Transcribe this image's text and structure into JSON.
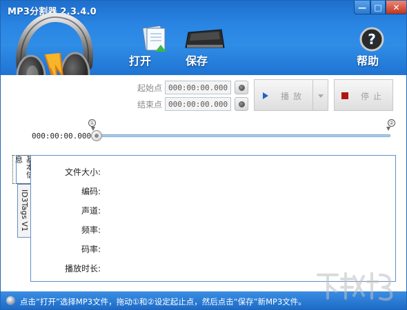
{
  "window": {
    "title": "MP3分割器 2.3.4.0",
    "minimize_label": "—",
    "maximize_label": "□",
    "close_label": "✕"
  },
  "toolbar": {
    "open_label": "打开",
    "save_label": "保存",
    "help_label": "帮助"
  },
  "controls": {
    "start_label": "起始点",
    "start_value": "000:00:00.000",
    "end_label": "结束点",
    "end_value": "000:00:00.000",
    "play_label": "播放",
    "stop_label": "停止"
  },
  "slider": {
    "current_time": "000:00:00.000",
    "position": 0,
    "marker_start": "①",
    "marker_end": "②"
  },
  "tabs": [
    {
      "label": "基本信息"
    },
    {
      "label": "ID3Tags V1"
    }
  ],
  "info_fields": [
    {
      "label": "文件大小:",
      "value": ""
    },
    {
      "label": "编码:",
      "value": ""
    },
    {
      "label": "声道:",
      "value": ""
    },
    {
      "label": "频率:",
      "value": ""
    },
    {
      "label": "码率:",
      "value": ""
    },
    {
      "label": "播放时长:",
      "value": ""
    }
  ],
  "status": {
    "text": "点击“打开”选择MP3文件，拖动①和②设定起止点，然后点击“保存”新MP3文件。"
  },
  "colors": {
    "header_blue": "#2a86e4",
    "panel_border": "#5f8fc7",
    "stop_red": "#b21414",
    "play_blue": "#1e62c8"
  }
}
